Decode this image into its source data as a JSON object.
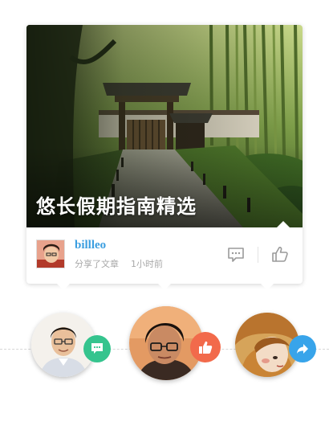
{
  "article": {
    "title": "悠长假期指南精选"
  },
  "author": {
    "name": "billleo",
    "action": "分享了文章",
    "time": "1小时前"
  },
  "actions": {
    "comment_icon": "comment-icon",
    "like_icon": "thumbs-up-icon"
  },
  "users": [
    {
      "badge": "comment-icon",
      "badge_color": "#35c48e"
    },
    {
      "badge": "thumbs-up-icon",
      "badge_color": "#f26a4b"
    },
    {
      "badge": "share-arrow-icon",
      "badge_color": "#38a4ea"
    }
  ],
  "colors": {
    "author_name": "#3b9ee0",
    "meta_text": "#a8a8a8"
  }
}
